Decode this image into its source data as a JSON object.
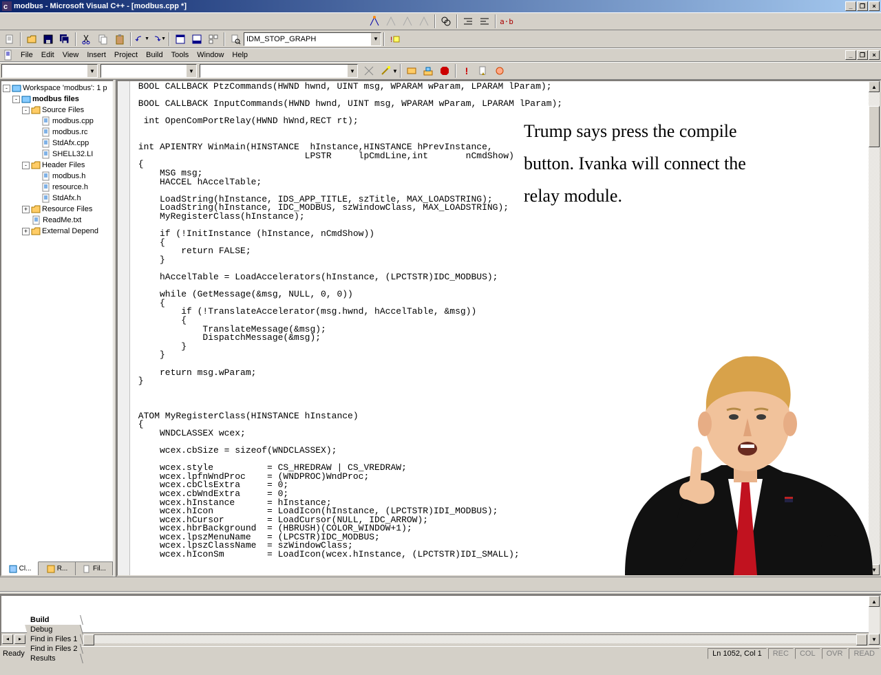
{
  "title": "modbus - Microsoft Visual C++ - [modbus.cpp *]",
  "menus": [
    "File",
    "Edit",
    "View",
    "Insert",
    "Project",
    "Build",
    "Tools",
    "Window",
    "Help"
  ],
  "combo_main": "IDM_STOP_GRAPH",
  "workspace": {
    "root": "Workspace 'modbus': 1 p",
    "project": "modbus files",
    "folders": [
      {
        "name": "Source Files",
        "expanded": true,
        "items": [
          "modbus.cpp",
          "modbus.rc",
          "StdAfx.cpp",
          "SHELL32.LI"
        ]
      },
      {
        "name": "Header Files",
        "expanded": true,
        "items": [
          "modbus.h",
          "resource.h",
          "StdAfx.h"
        ]
      },
      {
        "name": "Resource Files",
        "expanded": false,
        "items": []
      },
      {
        "name": "ReadMe.txt",
        "leaf": true
      },
      {
        "name": "External Depend",
        "expanded": false,
        "items": []
      }
    ],
    "tabs": [
      "Cl...",
      "R...",
      "Fil..."
    ]
  },
  "code": " BOOL CALLBACK PtzCommands(HWND hwnd, UINT msg, WPARAM wParam, LPARAM lParam);\n\n BOOL CALLBACK InputCommands(HWND hwnd, UINT msg, WPARAM wParam, LPARAM lParam);\n\n  int OpenComPortRelay(HWND hWnd,RECT rt);\n\n\n int APIENTRY WinMain(HINSTANCE  hInstance,HINSTANCE hPrevInstance,\n                                LPSTR     lpCmdLine,int       nCmdShow)\n {\n     MSG msg;\n     HACCEL hAccelTable;\n\n     LoadString(hInstance, IDS_APP_TITLE, szTitle, MAX_LOADSTRING);\n     LoadString(hInstance, IDC_MODBUS, szWindowClass, MAX_LOADSTRING);\n     MyRegisterClass(hInstance);\n\n     if (!InitInstance (hInstance, nCmdShow))\n     {\n         return FALSE;\n     }\n\n     hAccelTable = LoadAccelerators(hInstance, (LPCTSTR)IDC_MODBUS);\n\n     while (GetMessage(&msg, NULL, 0, 0))\n     {\n         if (!TranslateAccelerator(msg.hwnd, hAccelTable, &msg))\n         {\n             TranslateMessage(&msg);\n             DispatchMessage(&msg);\n         }\n     }\n\n     return msg.wParam;\n }\n\n\n\n ATOM MyRegisterClass(HINSTANCE hInstance)\n {\n     WNDCLASSEX wcex;\n\n     wcex.cbSize = sizeof(WNDCLASSEX);\n\n     wcex.style          = CS_HREDRAW | CS_VREDRAW;\n     wcex.lpfnWndProc    = (WNDPROC)WndProc;\n     wcex.cbClsExtra     = 0;\n     wcex.cbWndExtra     = 0;\n     wcex.hInstance      = hInstance;\n     wcex.hIcon          = LoadIcon(hInstance, (LPCTSTR)IDI_MODBUS);\n     wcex.hCursor        = LoadCursor(NULL, IDC_ARROW);\n     wcex.hbrBackground  = (HBRUSH)(COLOR_WINDOW+1);\n     wcex.lpszMenuName   = (LPCSTR)IDC_MODBUS;\n     wcex.lpszClassName  = szWindowClass;\n     wcex.hIconSm        = LoadIcon(wcex.hInstance, (LPCTSTR)IDI_SMALL);\n",
  "caption": "Trump says press the compile button. Ivanka will connect the relay module.",
  "output_tabs": [
    "Build",
    "Debug",
    "Find in Files 1",
    "Find in Files 2",
    "Results"
  ],
  "status": {
    "text": "Ready",
    "pos": "Ln 1052, Col 1",
    "flags": [
      "REC",
      "COL",
      "OVR",
      "READ"
    ]
  }
}
